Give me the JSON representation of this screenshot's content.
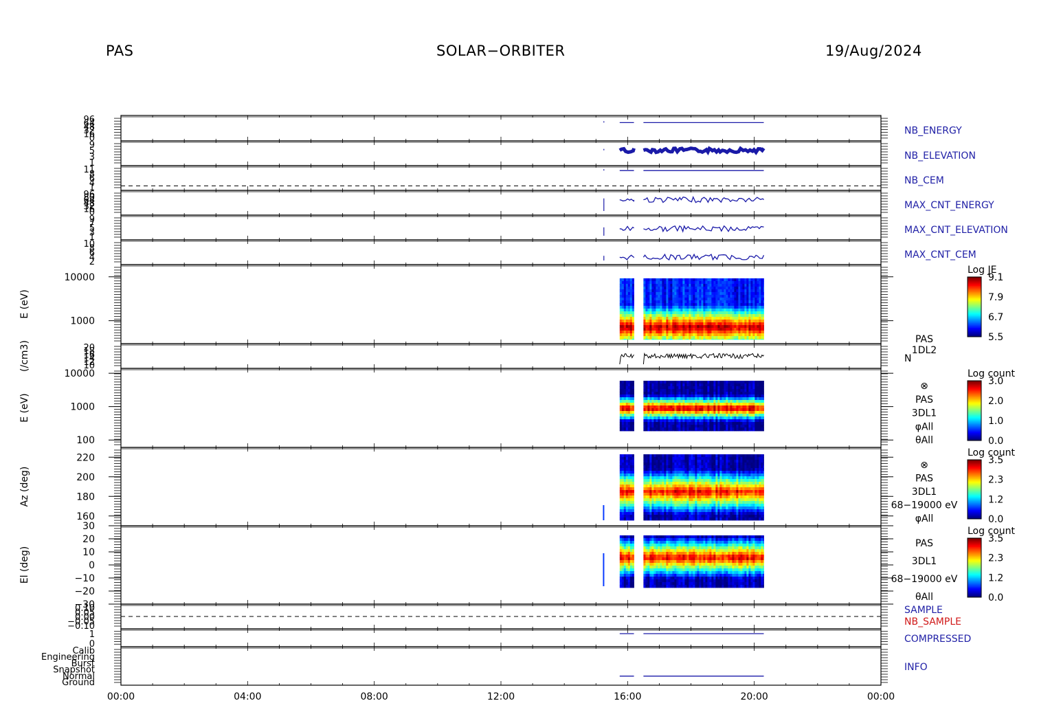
{
  "header": {
    "left": "PAS",
    "center": "SOLAR−ORBITER",
    "right": "19/Aug/2024"
  },
  "colors": {
    "line_blue": "#1a1aa8",
    "label_blue": "#1f1fa6",
    "label_red": "#d01818"
  },
  "chart_data": {
    "type": "multi-panel time series with spectrograms",
    "x": {
      "unit": "hours",
      "range": [
        0,
        24
      ],
      "tick_labels": [
        "00:00",
        "04:00",
        "08:00",
        "12:00",
        "16:00",
        "20:00",
        "00:00"
      ],
      "tick_values": [
        0,
        4,
        8,
        12,
        16,
        20,
        24
      ]
    },
    "data_intervals": [
      [
        15.75,
        16.2
      ],
      [
        16.5,
        20.3
      ]
    ],
    "panels": [
      {
        "id": "nb_energy",
        "type": "line",
        "label": "NB_ENERGY",
        "label_color": "blue",
        "y_tick_labels": [
          "96",
          "64",
          "48",
          "32",
          "16",
          "0"
        ],
        "level_fraction": 0.72
      },
      {
        "id": "nb_elevation",
        "type": "line",
        "label": "NB_ELEVATION",
        "label_color": "blue",
        "y_tick_labels": [
          "9",
          "5",
          "3",
          "1"
        ],
        "level_fraction": 0.62
      },
      {
        "id": "nb_cem",
        "type": "line",
        "label": "NB_CEM",
        "label_color": "blue",
        "y_tick_labels": [
          "11",
          "8",
          "6",
          "4",
          "1"
        ],
        "level_fraction": 0.8,
        "dashed_fraction": 0.18
      },
      {
        "id": "max_cnt_energy",
        "type": "line",
        "label": "MAX_CNT_ENERGY",
        "label_color": "blue",
        "y_tick_labels": [
          "96",
          "80",
          "64",
          "48",
          "32",
          "16",
          "0"
        ],
        "level_fraction": 0.62
      },
      {
        "id": "max_cnt_elevation",
        "type": "line",
        "label": "MAX_CNT_ELEVATION",
        "label_color": "blue",
        "y_tick_labels": [
          "9",
          "7",
          "5",
          "3",
          "1"
        ],
        "level_fraction": 0.45
      },
      {
        "id": "max_cnt_cem",
        "type": "line",
        "label": "MAX_CNT_CEM",
        "label_color": "blue",
        "y_tick_labels": [
          "10",
          "8",
          "6",
          "4",
          "2"
        ],
        "level_fraction": 0.3
      },
      {
        "id": "pas_e_1d",
        "type": "heatmap",
        "ylabel": "E (eV)",
        "y_scale": "log",
        "ylim": [
          300,
          19000
        ],
        "y_tick_labels": [
          "10000",
          "1000"
        ],
        "y_tick_values": [
          10000,
          1000
        ],
        "peak_value": 750,
        "colorbar": {
          "title": "Log JE",
          "ticks": [
            "9.1",
            "7.9",
            "6.7",
            "5.5"
          ],
          "range": [
            5.5,
            9.1
          ]
        }
      },
      {
        "id": "density",
        "type": "line",
        "ylabel": "(/cm3)",
        "label": "N",
        "y_tick_labels": [
          "20",
          "18",
          "16",
          "14",
          "12",
          "10"
        ],
        "ylim": [
          10,
          20
        ],
        "mean_value": 15,
        "side_label": [
          "PAS",
          "1DL2"
        ]
      },
      {
        "id": "pas_e_3d",
        "type": "heatmap",
        "ylabel": "E (eV)",
        "y_scale": "log",
        "ylim": [
          60,
          14000
        ],
        "y_tick_labels": [
          "10000",
          "1000",
          "100"
        ],
        "y_tick_values": [
          10000,
          1000,
          100
        ],
        "peak_value": 800,
        "colorbar": {
          "title": "Log count",
          "ticks": [
            "3.0",
            "2.0",
            "1.0",
            "0.0"
          ],
          "range": [
            0,
            3
          ]
        },
        "side_label": [
          "⊗",
          "PAS",
          "3DL1",
          "φAll",
          "θAll"
        ]
      },
      {
        "id": "pas_az",
        "type": "heatmap",
        "ylabel": "Az (deg)",
        "ylim": [
          150,
          230
        ],
        "y_tick_labels": [
          "220",
          "200",
          "180",
          "160"
        ],
        "y_tick_values": [
          220,
          200,
          180,
          160
        ],
        "colorbar": {
          "title": "Log count",
          "ticks": [
            "3.5",
            "2.3",
            "1.2",
            "0.0"
          ],
          "range": [
            0,
            3.5
          ]
        },
        "side_label": [
          "⊗",
          "PAS",
          "3DL1",
          "68−19000 eV",
          "φAll"
        ]
      },
      {
        "id": "pas_el",
        "type": "heatmap",
        "ylabel": "El (deg)",
        "ylim": [
          -30,
          30
        ],
        "y_tick_labels": [
          "30",
          "20",
          "10",
          "0",
          "−10",
          "−20",
          "−30"
        ],
        "y_tick_values": [
          30,
          20,
          10,
          0,
          -10,
          -20,
          -30
        ],
        "colorbar": {
          "title": "Log count",
          "ticks": [
            "3.5",
            "2.3",
            "1.2",
            "0.0"
          ],
          "range": [
            0,
            3.5
          ]
        },
        "side_label": [
          "PAS",
          "3DL1",
          "68−19000 eV",
          "θAll"
        ]
      },
      {
        "id": "sample",
        "type": "line",
        "label": "SAMPLE",
        "label2": "NB_SAMPLE",
        "y_tick_labels": [
          "0.10",
          "0.05",
          "0.00",
          "−0.05",
          "−0.10"
        ]
      },
      {
        "id": "compressed",
        "type": "line",
        "label": "COMPRESSED",
        "label_color": "blue",
        "y_tick_labels": [
          "1",
          "0"
        ],
        "value": 1
      },
      {
        "id": "info",
        "type": "line",
        "label": "INFO",
        "y_tick_labels": [
          "Calib",
          "Engineering",
          "Burst",
          "Snapshot",
          "Normal",
          "Ground"
        ],
        "value": "Normal"
      }
    ]
  }
}
